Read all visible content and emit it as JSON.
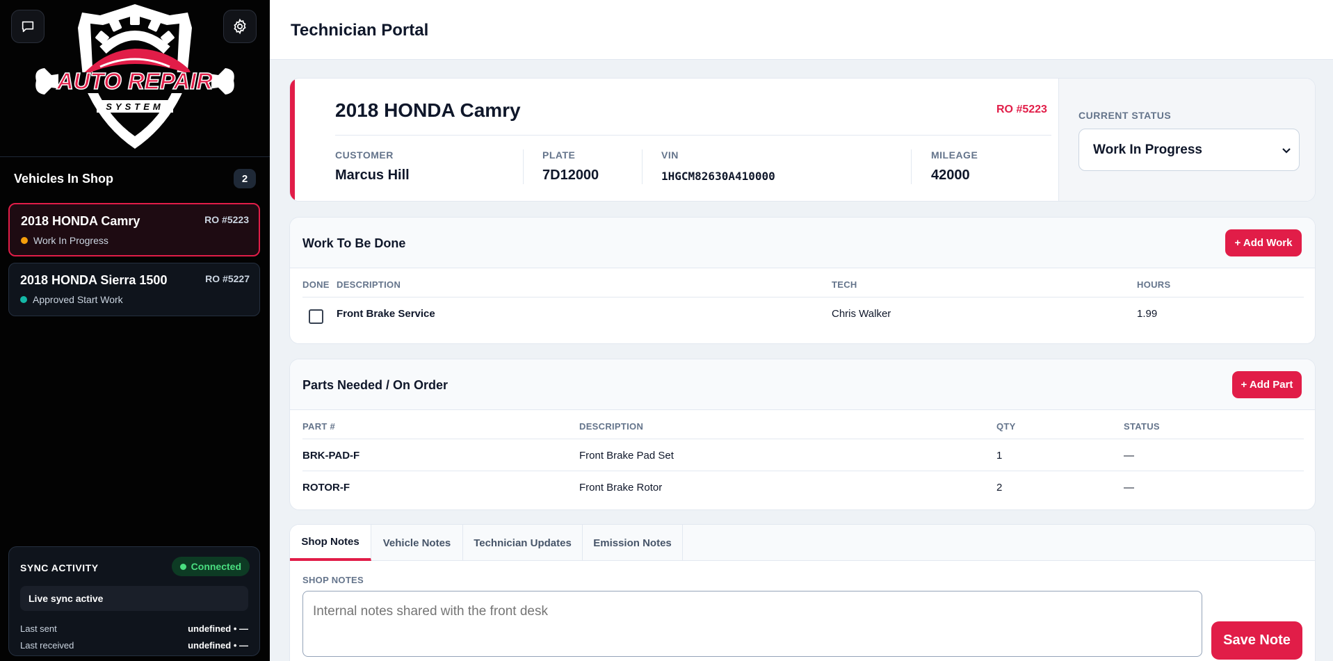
{
  "sidebar": {
    "vehicles_heading": "Vehicles In Shop",
    "vehicles_count": "2",
    "vehicles": [
      {
        "name": "2018 HONDA Camry",
        "ro": "RO #5223",
        "status": "Work In Progress",
        "status_color": "#f59e0b",
        "active": true
      },
      {
        "name": "2018 HONDA Sierra 1500",
        "ro": "RO #5227",
        "status": "Approved Start Work",
        "status_color": "#14b8a6",
        "active": false
      }
    ],
    "sync": {
      "title": "SYNC ACTIVITY",
      "connection": "Connected",
      "live": "Live sync active",
      "last_sent_label": "Last sent",
      "last_sent_value": "undefined • —",
      "last_received_label": "Last received",
      "last_received_value": "undefined • —"
    },
    "logo": {
      "line1": "AUTO REPAIR",
      "line2": "SYSTEM"
    }
  },
  "header": {
    "title": "Technician Portal"
  },
  "vehicle": {
    "title": "2018 HONDA Camry",
    "ro": "RO #5223",
    "customer_label": "CUSTOMER",
    "customer": "Marcus Hill",
    "plate_label": "PLATE",
    "plate": "7D12000",
    "vin_label": "VIN",
    "vin": "1HGCM82630A410000",
    "mileage_label": "MILEAGE",
    "mileage": "42000",
    "status_label": "CURRENT STATUS",
    "status": "Work In Progress"
  },
  "work": {
    "title": "Work To Be Done",
    "add_label": "+ Add Work",
    "columns": [
      "DONE",
      "DESCRIPTION",
      "TECH",
      "HOURS"
    ],
    "rows": [
      {
        "description": "Front Brake Service",
        "tech": "Chris Walker",
        "hours": "1.99"
      }
    ]
  },
  "parts": {
    "title": "Parts Needed / On Order",
    "add_label": "+ Add Part",
    "columns": [
      "PART #",
      "DESCRIPTION",
      "QTY",
      "STATUS"
    ],
    "rows": [
      {
        "part": "BRK-PAD-F",
        "description": "Front Brake Pad Set",
        "qty": "1",
        "status": "—"
      },
      {
        "part": "ROTOR-F",
        "description": "Front Brake Rotor",
        "qty": "2",
        "status": "—"
      }
    ]
  },
  "notes": {
    "tabs": [
      "Shop Notes",
      "Vehicle Notes",
      "Technician Updates",
      "Emission Notes"
    ],
    "field_label": "SHOP NOTES",
    "placeholder": "Internal notes shared with the front desk",
    "save_label": "Save Note"
  },
  "colors": {
    "accent": "#e11d48",
    "sidebar_bg": "#030303"
  }
}
